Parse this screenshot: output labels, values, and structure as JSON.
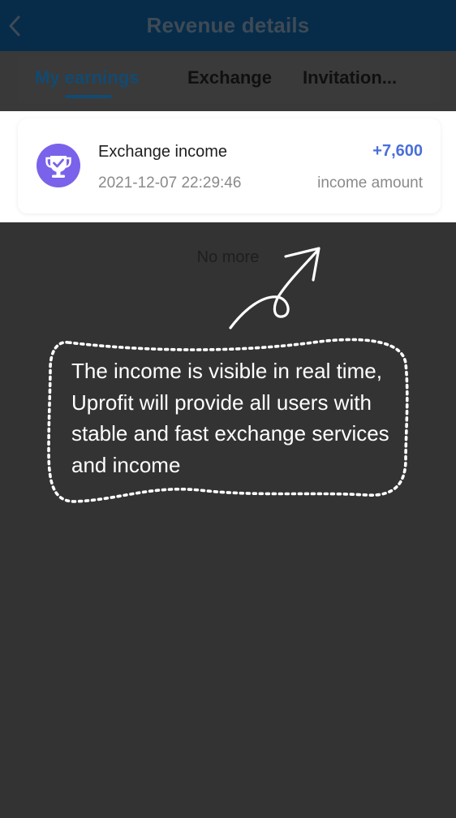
{
  "header": {
    "title": "Revenue details",
    "back_icon": "chevron-left-icon"
  },
  "tabs": [
    {
      "label": "My earnings",
      "active": true
    },
    {
      "label": "Exchange",
      "active": false
    },
    {
      "label": "Invitation...",
      "active": false
    }
  ],
  "records": [
    {
      "title": "Exchange income",
      "datetime": "2021-12-07 22:29:46",
      "amount": "+7,600",
      "amount_label": "income amount",
      "icon": "trophy-icon"
    }
  ],
  "list_footer": "No more",
  "annotation": {
    "text": "The income is visible in real time, Uprofit will provide all users with stable and fast exchange services and income"
  },
  "colors": {
    "header_bg": "#062c4a",
    "active_tab": "#124a72",
    "amount": "#4a6fd8",
    "icon_purple": "#7b62ea",
    "overlay": "#333333"
  }
}
